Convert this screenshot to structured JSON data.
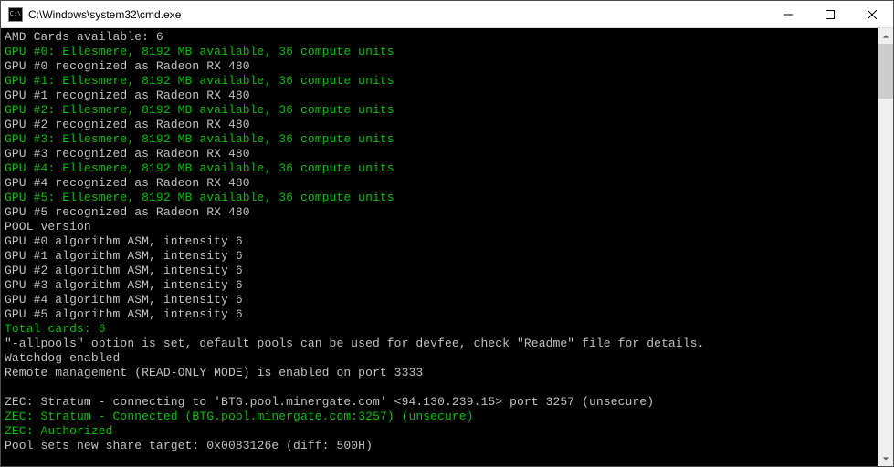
{
  "window": {
    "title": "C:\\Windows\\system32\\cmd.exe"
  },
  "lines": [
    {
      "t": "AMD Cards available: 6",
      "c": "white"
    },
    {
      "t": "GPU #0: Ellesmere, 8192 MB available, 36 compute units",
      "c": "green"
    },
    {
      "t": "GPU #0 recognized as Radeon RX 480",
      "c": "white"
    },
    {
      "t": "GPU #1: Ellesmere, 8192 MB available, 36 compute units",
      "c": "green"
    },
    {
      "t": "GPU #1 recognized as Radeon RX 480",
      "c": "white"
    },
    {
      "t": "GPU #2: Ellesmere, 8192 MB available, 36 compute units",
      "c": "green"
    },
    {
      "t": "GPU #2 recognized as Radeon RX 480",
      "c": "white"
    },
    {
      "t": "GPU #3: Ellesmere, 8192 MB available, 36 compute units",
      "c": "green"
    },
    {
      "t": "GPU #3 recognized as Radeon RX 480",
      "c": "white"
    },
    {
      "t": "GPU #4: Ellesmere, 8192 MB available, 36 compute units",
      "c": "green"
    },
    {
      "t": "GPU #4 recognized as Radeon RX 480",
      "c": "white"
    },
    {
      "t": "GPU #5: Ellesmere, 8192 MB available, 36 compute units",
      "c": "green"
    },
    {
      "t": "GPU #5 recognized as Radeon RX 480",
      "c": "white"
    },
    {
      "t": "POOL version",
      "c": "white"
    },
    {
      "t": "GPU #0 algorithm ASM, intensity 6",
      "c": "white"
    },
    {
      "t": "GPU #1 algorithm ASM, intensity 6",
      "c": "white"
    },
    {
      "t": "GPU #2 algorithm ASM, intensity 6",
      "c": "white"
    },
    {
      "t": "GPU #3 algorithm ASM, intensity 6",
      "c": "white"
    },
    {
      "t": "GPU #4 algorithm ASM, intensity 6",
      "c": "white"
    },
    {
      "t": "GPU #5 algorithm ASM, intensity 6",
      "c": "white"
    },
    {
      "t": "Total cards: 6",
      "c": "green"
    },
    {
      "t": "\"-allpools\" option is set, default pools can be used for devfee, check \"Readme\" file for details.",
      "c": "white"
    },
    {
      "t": "Watchdog enabled",
      "c": "white"
    },
    {
      "t": "Remote management (READ-ONLY MODE) is enabled on port 3333",
      "c": "white"
    },
    {
      "t": " ",
      "c": "white"
    },
    {
      "t": "ZEC: Stratum - connecting to 'BTG.pool.minergate.com' <94.130.239.15> port 3257 (unsecure)",
      "c": "white"
    },
    {
      "t": "ZEC: Stratum - Connected (BTG.pool.minergate.com:3257) (unsecure)",
      "c": "green"
    },
    {
      "t": "ZEC: Authorized",
      "c": "green"
    },
    {
      "t": "Pool sets new share target: 0x0083126e (diff: 500H)",
      "c": "white"
    }
  ]
}
